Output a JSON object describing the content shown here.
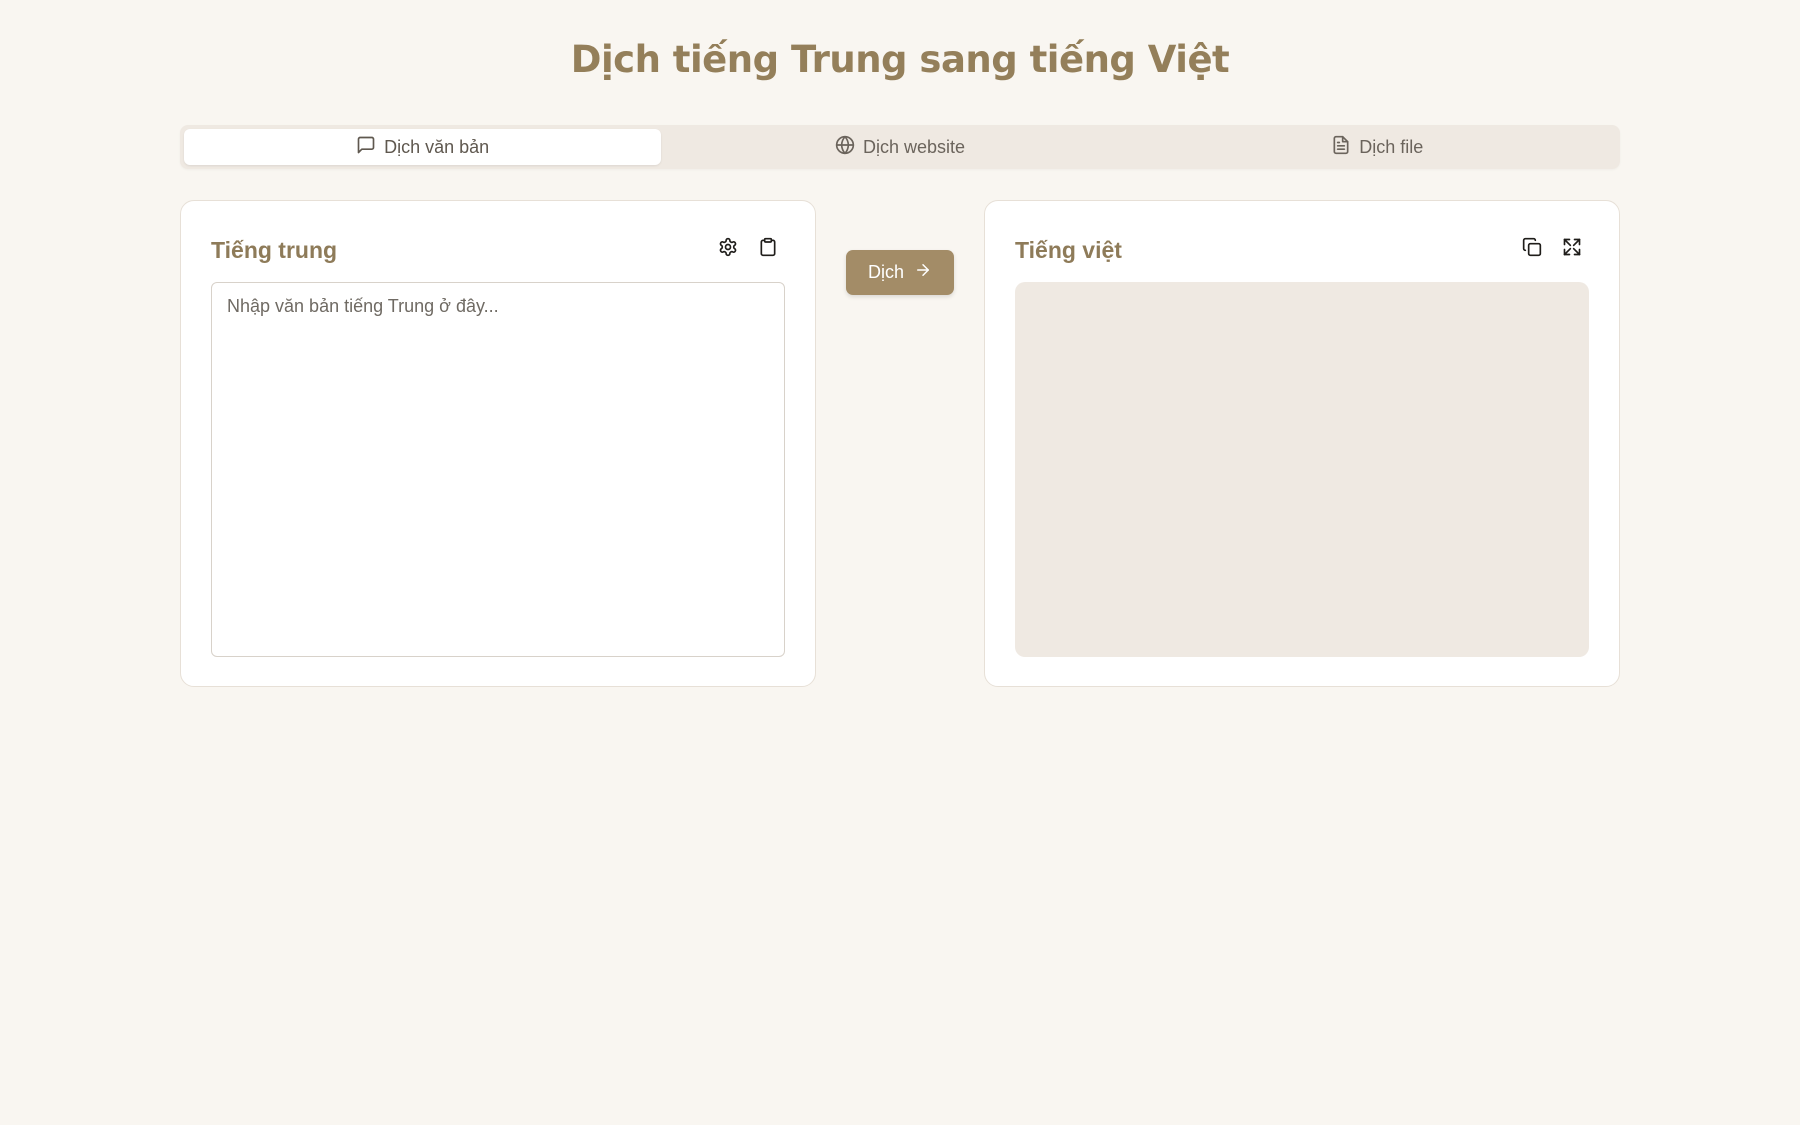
{
  "page": {
    "title": "Dịch tiếng Trung sang tiếng Việt"
  },
  "colors": {
    "accent": "#947f5a",
    "button": "#a38c67",
    "background": "#f9f6f1",
    "panel_muted": "#efe9e2"
  },
  "tabs": [
    {
      "label": "Dịch văn bản",
      "icon": "message-square-icon",
      "active": true
    },
    {
      "label": "Dịch website",
      "icon": "globe-icon",
      "active": false
    },
    {
      "label": "Dịch file",
      "icon": "file-text-icon",
      "active": false
    }
  ],
  "source": {
    "title": "Tiếng trung",
    "placeholder": "Nhập văn bản tiếng Trung ở đây...",
    "value": "",
    "actions": [
      {
        "icon": "settings-gear-icon"
      },
      {
        "icon": "clipboard-paste-icon"
      }
    ]
  },
  "translate_button": {
    "label": "Dịch",
    "icon": "arrow-right-icon"
  },
  "target": {
    "title": "Tiếng việt",
    "value": "",
    "actions": [
      {
        "icon": "copy-icon"
      },
      {
        "icon": "fullscreen-expand-icon"
      }
    ]
  }
}
